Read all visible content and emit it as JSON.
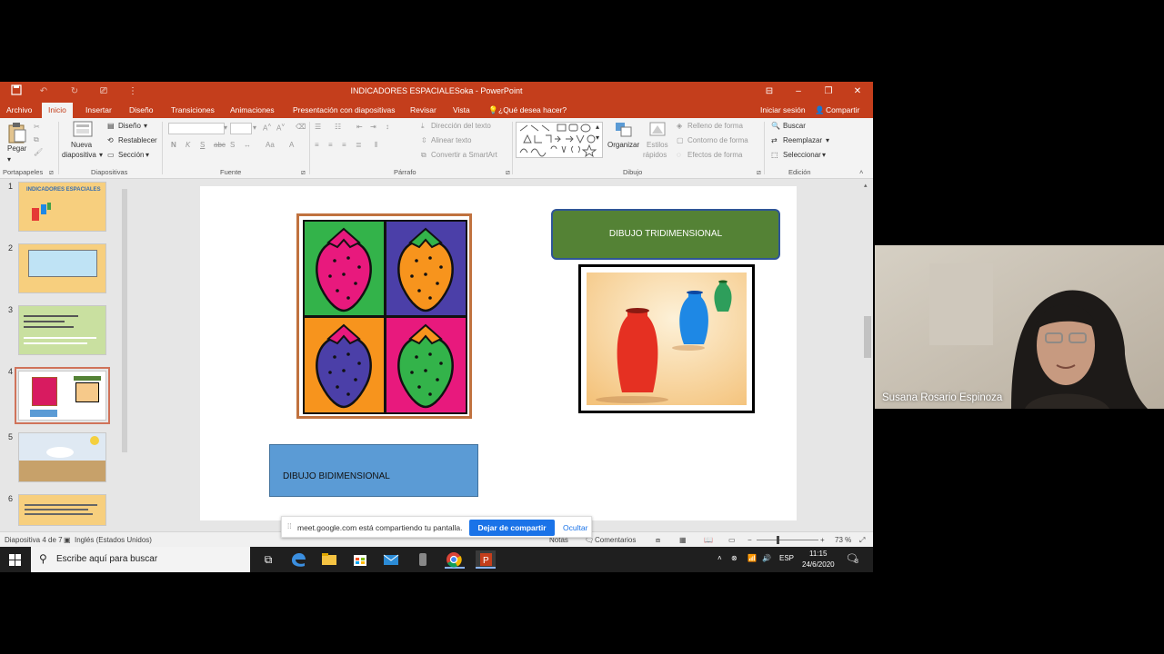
{
  "window": {
    "title": "INDICADORES ESPACIALESoka - PowerPoint",
    "signin": "Iniciar sesión",
    "share": "Compartir"
  },
  "menu": {
    "tabs": [
      "Archivo",
      "Inicio",
      "Insertar",
      "Diseño",
      "Transiciones",
      "Animaciones",
      "Presentación con diapositivas",
      "Revisar",
      "Vista"
    ],
    "tell_me": "¿Qué desea hacer?"
  },
  "ribbon": {
    "paste": "Pegar",
    "new_slide": [
      "Nueva",
      "diapositiva"
    ],
    "design": "Diseño",
    "reset": "Restablecer",
    "section": "Sección",
    "text_direction": "Dirección del texto",
    "align_text": "Alinear texto",
    "convert_smartart": "Convertir a SmartArt",
    "arrange": "Organizar",
    "quick_styles": [
      "Estilos",
      "rápidos"
    ],
    "shape_fill": "Relleno de forma",
    "shape_outline": "Contorno de forma",
    "shape_effects": "Efectos de forma",
    "find": "Buscar",
    "replace": "Reemplazar",
    "select": "Seleccionar",
    "groups": [
      "Portapapeles",
      "Diapositivas",
      "Fuente",
      "Párrafo",
      "Dibujo",
      "Edición"
    ],
    "font_buttons": [
      "N",
      "K",
      "S",
      "abc",
      "S"
    ]
  },
  "thumbnails": {
    "numbers": [
      "1",
      "2",
      "3",
      "4",
      "5",
      "6"
    ],
    "slide1_title": "INDICADORES ESPACIALES"
  },
  "slide": {
    "box_3d": "DIBUJO TRIDIMENSIONAL",
    "box_2d": "DIBUJO BIDIMENSIONAL"
  },
  "status": {
    "slide_counter": "Diapositiva 4 de 7",
    "language": "Inglés (Estados Unidos)",
    "notes": "Notas",
    "comments": "Comentarios",
    "zoom": "73 %"
  },
  "share_banner": {
    "message": "meet.google.com está compartiendo tu pantalla.",
    "stop": "Dejar de compartir",
    "hide": "Ocultar"
  },
  "taskbar": {
    "search_placeholder": "Escribe aquí para buscar",
    "lang": "ESP",
    "time": "11:15",
    "date": "24/6/2020",
    "notifications": "8"
  },
  "video": {
    "participant": "Susana Rosario Espinoza"
  },
  "colors": {
    "titlebar": "#c43e1c",
    "accent_blue": "#1a73e8",
    "box_green": "#548235",
    "box_blue": "#5b9bd5"
  }
}
